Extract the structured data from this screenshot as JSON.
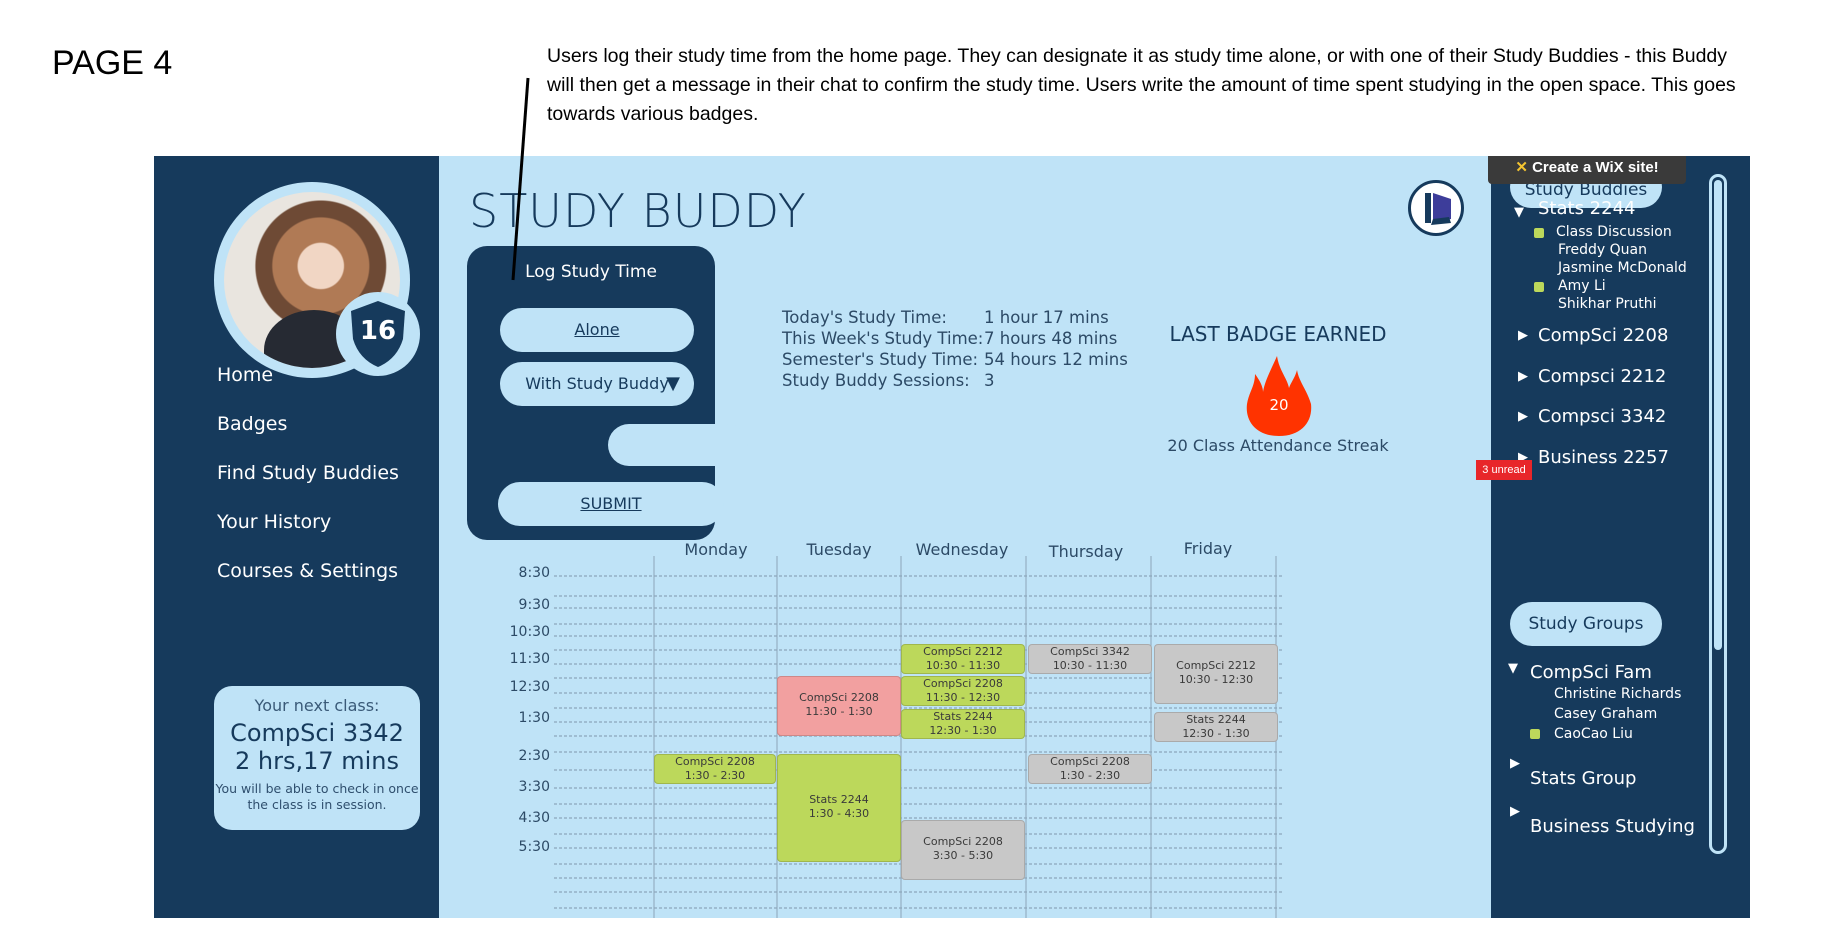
{
  "annotation": {
    "page_label": "PAGE 4",
    "note": "Users log their study time from the home page. They can designate it as study time alone, or with one of their Study Buddies - this Buddy will then get a message in their chat to confirm the study time. Users write the amount of time spent studying in the open space. This goes towards various badges."
  },
  "app": {
    "title": "STUDY BUDDY",
    "level": "16",
    "nav": [
      "Home",
      "Badges",
      "Find Study Buddies",
      "Your History",
      "Courses & Settings"
    ],
    "next_class": {
      "label": "Your next class:",
      "course": "CompSci 3342",
      "time": "2 hrs,17 mins",
      "note": "You will be able to check in once the class is in session."
    },
    "log": {
      "title": "Log Study Time",
      "alone": "Alone",
      "with_buddy": "With Study Buddy",
      "arrow": "▼",
      "time_value": "",
      "submit": "SUBMIT"
    },
    "stats": [
      {
        "label": "Today's Study Time:",
        "value": "1 hour 17 mins"
      },
      {
        "label": "This Week's Study Time:",
        "value": "7 hours 48 mins"
      },
      {
        "label": "Semester's Study Time:",
        "value": "54 hours 12 mins"
      },
      {
        "label": "Study Buddy Sessions:",
        "value": "3"
      }
    ],
    "badge": {
      "heading": "LAST BADGE EARNED",
      "number": "20",
      "name": "20 Class Attendance Streak",
      "color": "#ff3300"
    },
    "schedule": {
      "days": [
        "Monday",
        "Tuesday",
        "Wednesday",
        "Thursday",
        "Friday"
      ],
      "times": [
        "8:30",
        "9:30",
        "10:30",
        "11:30",
        "12:30",
        "1:30",
        "2:30",
        "3:30",
        "4:30",
        "5:30"
      ],
      "events": [
        {
          "course": "CompSci 2212",
          "time": "10:30 - 11:30",
          "color": "green"
        },
        {
          "course": "CompSci 2208",
          "time": "11:30 - 12:30",
          "color": "green"
        },
        {
          "course": "Stats 2244",
          "time": "12:30 - 1:30",
          "color": "green"
        },
        {
          "course": "CompSci 3342",
          "time": "10:30 - 11:30",
          "color": "gray"
        },
        {
          "course": "CompSci 2212",
          "time": "10:30 - 12:30",
          "color": "gray"
        },
        {
          "course": "CompSci 2208",
          "time": "11:30 - 1:30",
          "color": "red"
        },
        {
          "course": "Stats 2244",
          "time": "12:30 - 1:30",
          "color": "gray"
        },
        {
          "course": "CompSci 2208",
          "time": "1:30 - 2:30",
          "color": "green"
        },
        {
          "course": "Stats 2244",
          "time": "1:30 - 4:30",
          "color": "green"
        },
        {
          "course": "CompSci 2208",
          "time": "1:30 - 2:30",
          "color": "gray"
        },
        {
          "course": "CompSci 2208",
          "time": "3:30 - 5:30",
          "color": "gray"
        }
      ]
    },
    "sidebar": {
      "wix_banner": "Create a WiX site!",
      "study_buddies_label": "Study Buddies",
      "buddy_groups": [
        {
          "name": "Stats 2244",
          "expanded": true
        },
        {
          "name": "CompSci 2208",
          "expanded": false
        },
        {
          "name": "Compsci 2212",
          "expanded": false
        },
        {
          "name": "Compsci 3342",
          "expanded": false
        },
        {
          "name": "Business 2257",
          "expanded": false
        }
      ],
      "stats_members": [
        "Class Discussion",
        "Freddy Quan",
        "Jasmine McDonald",
        "Amy Li",
        "Shikhar Pruthi"
      ],
      "unread": "3 unread",
      "study_groups_label": "Study Groups",
      "groups": [
        {
          "name": "CompSci Fam",
          "expanded": true
        },
        {
          "name": "Stats Group",
          "expanded": false
        },
        {
          "name": "Business Studying",
          "expanded": false
        }
      ],
      "fam_members": [
        "Christine Richards",
        "Casey Graham",
        "CaoCao Liu"
      ],
      "online_color": "#bcd85b"
    },
    "colors": {
      "navy": "#163a5c",
      "light_blue": "#bfe3f7"
    }
  }
}
